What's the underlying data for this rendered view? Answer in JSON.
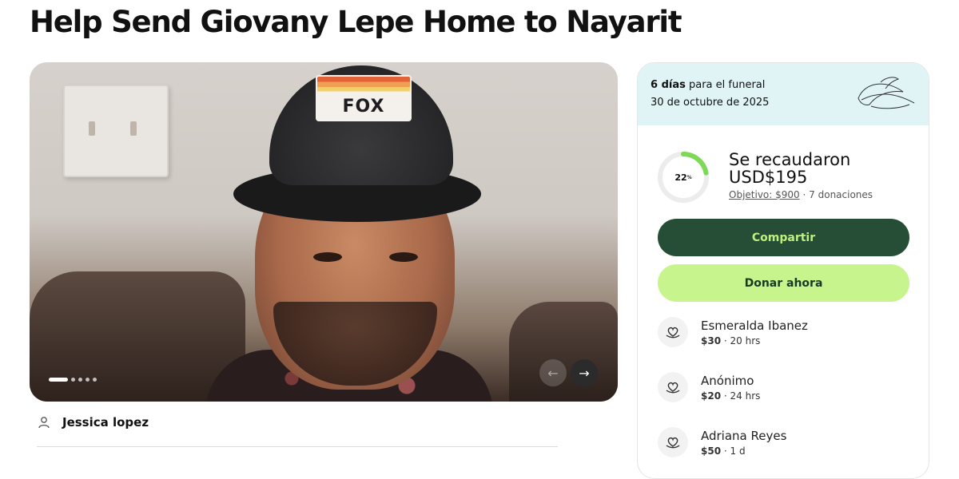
{
  "page": {
    "title": "Help Send Giovany Lepe Home to Nayarit"
  },
  "hero": {
    "cap_text": "FOX",
    "carousel": {
      "slide_count": 5,
      "active_index": 0
    },
    "prev_icon": "arrow-left-icon",
    "next_icon": "arrow-right-icon",
    "prev_label": "←",
    "next_label": "→"
  },
  "organizer": {
    "icon": "user-icon",
    "name": "Jessica lopez"
  },
  "funeral": {
    "days_bold": "6 días",
    "days_rest": "para el funeral",
    "date": "30 de octubre de 2025",
    "icon": "leaf-icon"
  },
  "progress": {
    "percent": 22,
    "percent_label": "22",
    "percent_sign": "%",
    "title": "Se recaudaron USD$195",
    "goal": "Objetivo: $900",
    "separator": "·",
    "donations": "7 donaciones",
    "colors": {
      "fill": "#7ed957",
      "track": "#ececec"
    }
  },
  "buttons": {
    "share": "Compartir",
    "donate": "Donar ahora"
  },
  "colors": {
    "share_bg": "#264d35",
    "share_text": "#bff07f",
    "donate_bg": "#c8f48e",
    "banner_bg": "#e0f4f6"
  },
  "donations": [
    {
      "name": "Esmeralda Ibanez",
      "amount": "$30",
      "time": " · 20 hrs",
      "icon": "heart-hand-icon"
    },
    {
      "name": "Anónimo",
      "amount": "$20",
      "time": " · 24 hrs",
      "icon": "heart-hand-icon"
    },
    {
      "name": "Adriana Reyes",
      "amount": "$50",
      "time": " · 1 d",
      "icon": "heart-hand-icon"
    }
  ]
}
